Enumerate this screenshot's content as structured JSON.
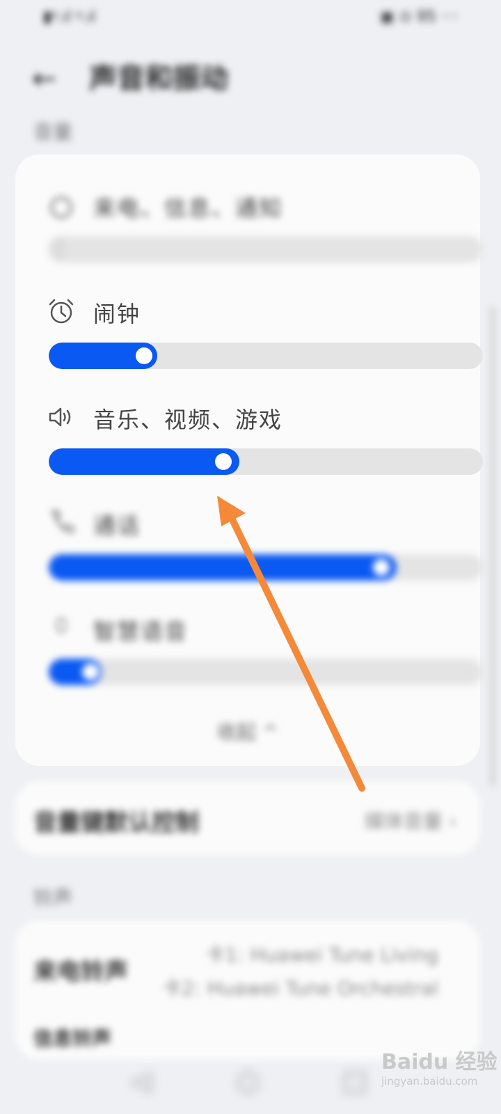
{
  "status_bar": {
    "left_text": "▮ᵍ.ıl ᵍ.ıl",
    "right_text": "▣ ⊙ 95 ◦◦"
  },
  "app_bar": {
    "title": "声音和振动"
  },
  "volume_section": {
    "header": "音量",
    "sliders": [
      {
        "label": "来电、信息、通知",
        "icon": "ringer-icon",
        "level": 0.03
      },
      {
        "label": "闹钟",
        "icon": "alarm-clock-icon",
        "level": 0.25
      },
      {
        "label": "音乐、视频、游戏",
        "icon": "speaker-icon",
        "level": 0.44
      },
      {
        "label": "通话",
        "icon": "phone-icon",
        "level": 0.8
      },
      {
        "label": "智慧语音",
        "icon": "voice-assistant-icon",
        "level": 0.1
      }
    ],
    "collapse_label": "收起 ^"
  },
  "sound_effect_row": {
    "label": "音量键默认控制",
    "value": "媒体音量 ›"
  },
  "ringtone_section": {
    "header": "铃声",
    "incoming_label": "来电铃声",
    "incoming_value_1": "卡1: Huawei Tune Living",
    "incoming_value_2": "卡2: Huawei Tune Orchestral",
    "next_label": "信息铃声"
  },
  "nav_bar": {
    "back": "◁",
    "home": "○",
    "recents": "□"
  },
  "watermark": {
    "main": "Baidu 经验",
    "sub": "jingyan.baidu.com"
  },
  "colors": {
    "accent": "#0a59f2",
    "arrow": "#f5893a"
  }
}
